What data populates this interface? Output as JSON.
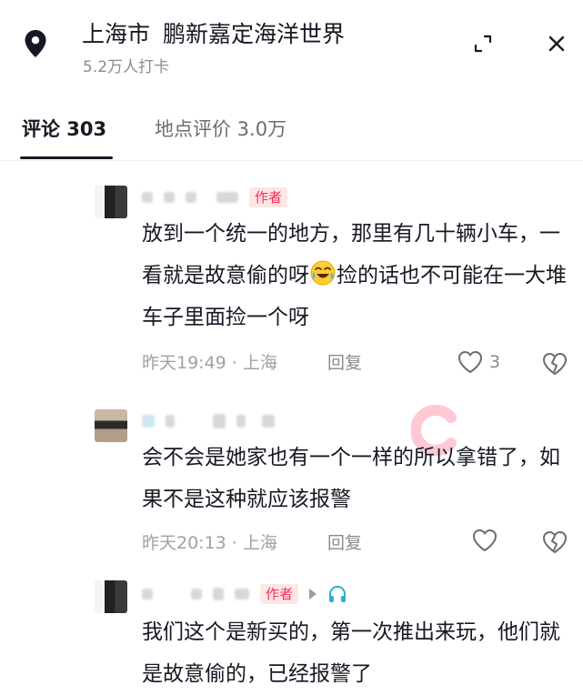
{
  "header": {
    "city": "上海市",
    "place": "鹏新嘉定海洋世界",
    "checkins": "5.2万人打卡"
  },
  "tabs": [
    {
      "label": "评论 303",
      "active": true
    },
    {
      "label": "地点评价 3.0万",
      "active": false
    }
  ],
  "comments": [
    {
      "author_badge": "作者",
      "text": "放到一个统一的地方，那里有几十辆小车，一看就是故意偷的呀",
      "text_after_emoji": "捡的话也不可能在一大堆车子里面捡一个呀",
      "emoji": "laughing-crying-emoji",
      "time": "昨天19:49 · 上海",
      "reply": "回复",
      "likes": "3"
    },
    {
      "author_badge": "",
      "text": "会不会是她家也有一个一样的所以拿错了，如果不是这种就应该报警",
      "time": "昨天20:13 · 上海",
      "reply": "回复",
      "likes": ""
    },
    {
      "author_badge": "作者",
      "text": "我们这个是新买的，第一次推出来玩，他们就是故意偷的，已经报警了",
      "time": "",
      "reply": "",
      "likes": ""
    }
  ],
  "colors": {
    "text": "#161823",
    "secondary": "#8a8b91",
    "badge_red": "#fe2c55",
    "badge_bg": "#fde6e6"
  }
}
